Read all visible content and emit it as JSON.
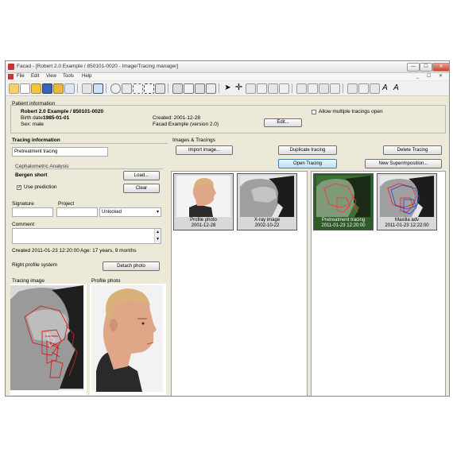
{
  "window": {
    "title": "Facad - [Robert 2.0 Example / 850101-0020 - Image/Tracing manager]",
    "min": "—",
    "max": "☐",
    "close": "✕"
  },
  "menu": [
    "File",
    "Edit",
    "View",
    "Tools",
    "Help"
  ],
  "mdi_buttons": "_ ☐ ✕",
  "toolbar_icons": [
    "new-icon",
    "new-doc-icon",
    "open-folder-icon",
    "save-icon",
    "close-folder-icon",
    "copy-icon",
    "paste-icon",
    "undo-icon",
    "zoom-icon",
    "zoom-out-icon",
    "zoom-fit-icon",
    "select-icon",
    "grid-icon",
    "rotate-icon",
    "page-icon",
    "crop-icon",
    "layers-icon",
    "pointer-icon",
    "crosshair-icon",
    "bone-icon",
    "tooth-icon",
    "measure-icon",
    "needle-icon",
    "wrench-icon",
    "tooth-tool-icon",
    "brush-icon",
    "tool-a-icon",
    "line-icon",
    "angle-icon",
    "text-a-icon",
    "text-a2-icon"
  ],
  "patient": {
    "section_label": "Patient information",
    "name": "Robert 2.0 Example / 850101-0020",
    "birth_label": "Birth date:",
    "birth_value": "1985-01-01",
    "sex": "Sex: male",
    "created": "Created: 2001-12-28",
    "facad": "Facad Example (version 2.0)",
    "edit_button": "Edit...",
    "allow_multiple": "Allow multiple tracings open"
  },
  "tracing": {
    "section_label": "Tracing information",
    "name_value": "Pretreatment tracing",
    "ceph_label": "Cephalometric Analysis",
    "analysis": "Bergen short",
    "load_button": "Load...",
    "clear_button": "Clear",
    "use_prediction": "Use prediction",
    "use_prediction_checked": true,
    "signature_label": "Signature",
    "project_label": "Project",
    "lock_value": "Unlocked",
    "comment_label": "Comment",
    "created_line": "Created 2011-01-23 12:20:00",
    "age_line": "Age: 17 years, 9 months",
    "profile_system": "Right profile system",
    "detach_button": "Detach photo",
    "tracing_image_label": "Tracing image",
    "profile_photo_label": "Profile photo"
  },
  "images": {
    "section_label": "Images & Tracings",
    "import_button": "Import image...",
    "duplicate_button": "Duplicate tracing",
    "delete_button": "Delete Tracing",
    "open_button": "Open Tracing",
    "new_super_button": "New Superimposition...",
    "left_items": [
      {
        "caption1": "Profile photo",
        "caption2": "2001-12-28"
      },
      {
        "caption1": "X-ray image",
        "caption2": "2002-10-22"
      }
    ],
    "right_items": [
      {
        "caption1": "Pretreatment tracing",
        "caption2": "2011-01-23 12:20:00"
      },
      {
        "caption1": "Maxilla adv",
        "caption2": "2011-01-23 12:22:00"
      }
    ]
  },
  "colors": {
    "selected": "#2f5a2a",
    "button_focus": "#3c7fb1",
    "tracing_red": "#cc2222"
  }
}
